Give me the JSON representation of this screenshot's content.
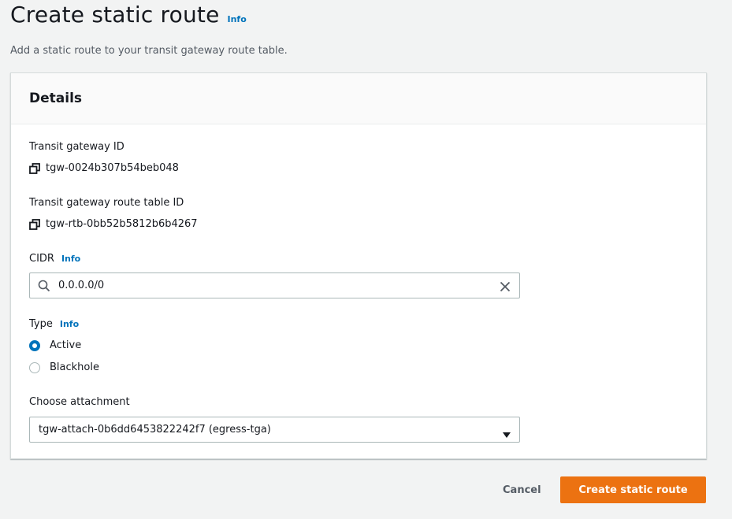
{
  "header": {
    "title": "Create static route",
    "info_label": "Info",
    "description": "Add a static route to your transit gateway route table."
  },
  "details": {
    "title": "Details",
    "transit_gateway_id": {
      "label": "Transit gateway ID",
      "value": "tgw-0024b307b54beb048",
      "icon": "copy-icon"
    },
    "route_table_id": {
      "label": "Transit gateway route table ID",
      "value": "tgw-rtb-0bb52b5812b6b4267",
      "icon": "copy-icon"
    },
    "cidr": {
      "label": "CIDR",
      "info_label": "Info",
      "value": "0.0.0.0/0",
      "search_icon": "search-icon",
      "clear_icon": "close-icon"
    },
    "type": {
      "label": "Type",
      "info_label": "Info",
      "options": [
        {
          "label": "Active",
          "checked": true
        },
        {
          "label": "Blackhole",
          "checked": false
        }
      ]
    },
    "attachment": {
      "label": "Choose attachment",
      "selected": "tgw-attach-0b6dd6453822242f7 (egress-tga)",
      "icon": "caret-down-icon"
    }
  },
  "actions": {
    "cancel_label": "Cancel",
    "submit_label": "Create static route"
  },
  "colors": {
    "link": "#0073bb",
    "primary": "#ec7211",
    "background": "#f2f3f3"
  }
}
